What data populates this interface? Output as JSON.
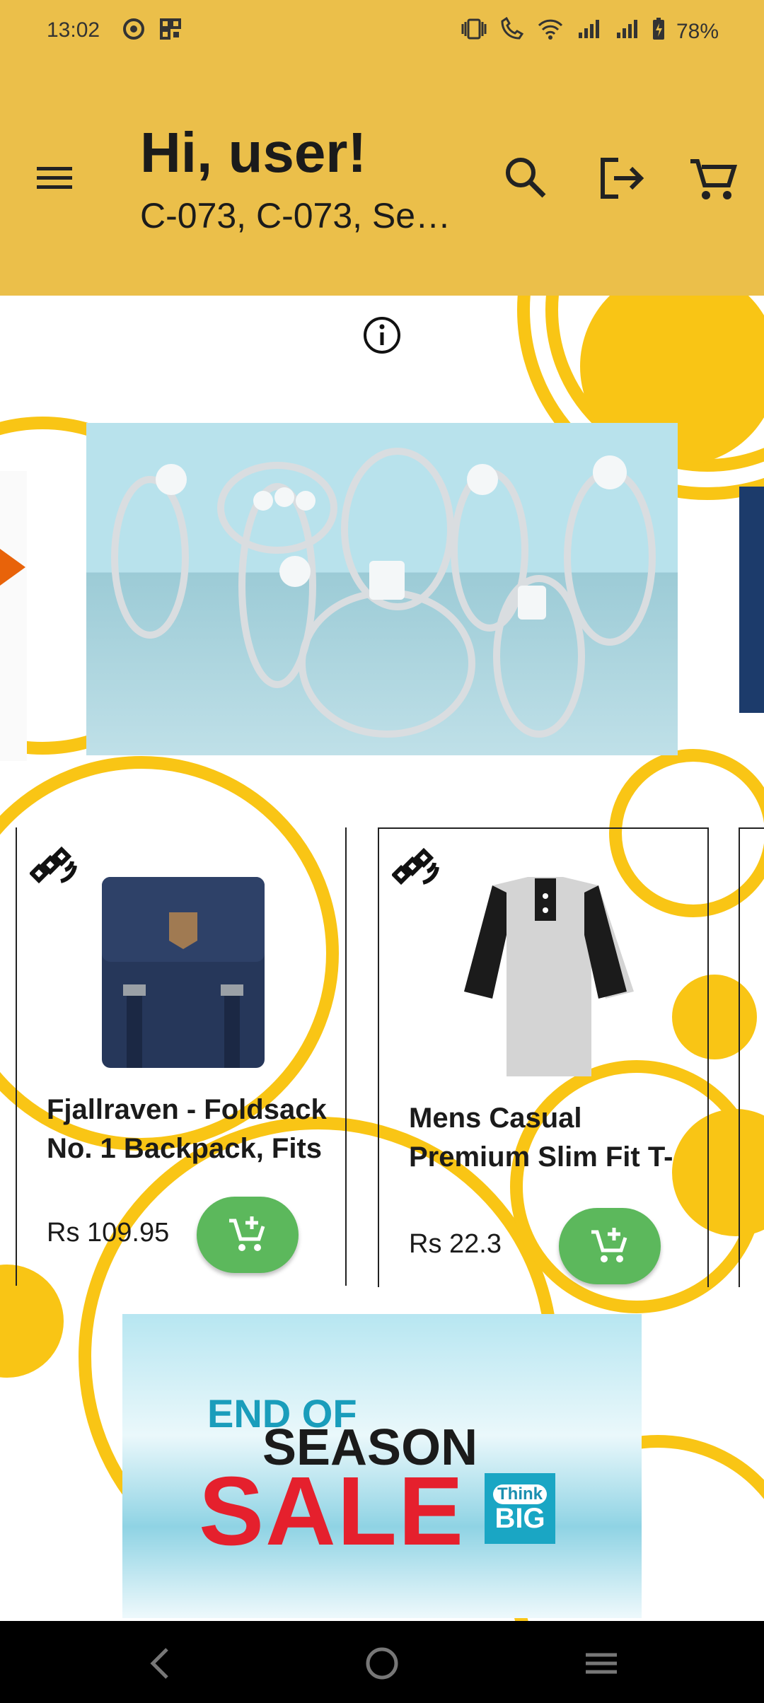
{
  "status_bar": {
    "time": "13:02",
    "battery": "78%",
    "icons": [
      "whatsapp-icon",
      "qr-icon",
      "vibrate-icon",
      "wifi-call-icon",
      "wifi-icon",
      "signal-icon",
      "signal-icon",
      "battery-charging-icon"
    ]
  },
  "header": {
    "greeting": "Hi, user!",
    "address": "C-073, C-073, Se…",
    "actions": [
      "search-icon",
      "logout-icon",
      "cart-icon"
    ],
    "background": "#EBBF4A"
  },
  "banner": {
    "info_icon": "info-icon",
    "image": "rings-banner"
  },
  "products": [
    {
      "title_line1": "Fjallraven - Foldsack",
      "title_line2": "No. 1 Backpack, Fits",
      "price": "Rs 109.95"
    },
    {
      "title_line1": "Mens Casual",
      "title_line2": "Premium Slim Fit T-",
      "price": "Rs 22.3"
    }
  ],
  "sale_banner": {
    "line1": "END OF",
    "line2": "SEASON",
    "line3": "SALE",
    "badge_top": "Think",
    "badge_bottom": "BIG"
  },
  "colors": {
    "accent": "#EBBF4A",
    "deco": "#F9C515",
    "add_button": "#5CB85C"
  }
}
